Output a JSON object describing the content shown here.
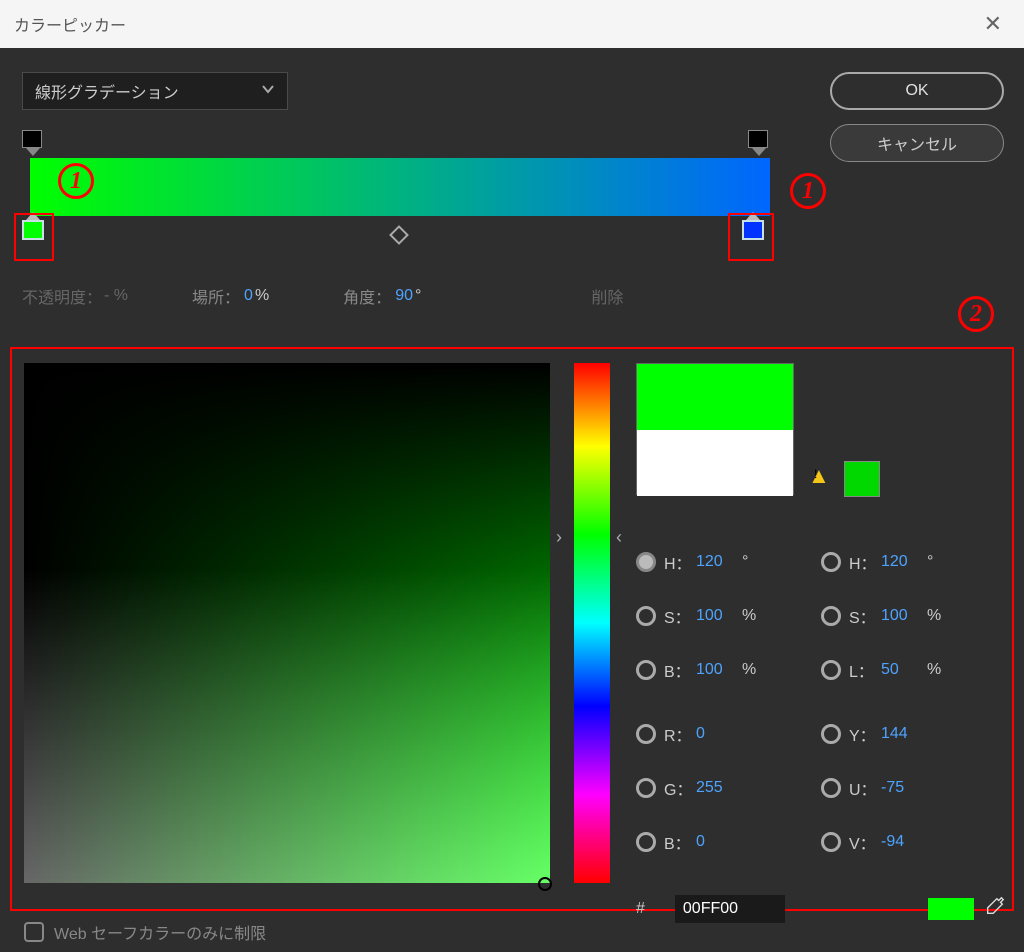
{
  "title": "カラーピッカー",
  "gradient_type": "線形グラデーション",
  "buttons": {
    "ok": "OK",
    "cancel": "キャンセル"
  },
  "gradient": {
    "start_color": "#00ff00",
    "end_color": "#0066ff"
  },
  "controls": {
    "opacity_label": "不透明度：",
    "opacity_value": "-  %",
    "location_label": "場所：",
    "location_value": "0",
    "location_unit": "%",
    "angle_label": "角度：",
    "angle_value": "90",
    "angle_unit": "°",
    "delete_label": "削除"
  },
  "annotations": {
    "one": "1",
    "two": "2"
  },
  "swatch": {
    "new_color": "#00ff00",
    "old_color": "#ffffff",
    "warn_color": "#00d800"
  },
  "hsb": {
    "h": "120",
    "s": "100",
    "b": "100"
  },
  "hsl": {
    "h": "120",
    "s": "100",
    "l": "50"
  },
  "rgb": {
    "r": "0",
    "g": "255",
    "b": "0"
  },
  "yuv": {
    "y": "144",
    "u": "-75",
    "v": "-94"
  },
  "labels": {
    "H": "H：",
    "S": "S：",
    "B": "B：",
    "L": "L：",
    "R": "R：",
    "G": "G：",
    "Y": "Y：",
    "U": "U：",
    "V": "V："
  },
  "units": {
    "deg": "°",
    "pct": "%"
  },
  "hex_prefix": "#",
  "hex_value": "00FF00",
  "websafe_label": "Web セーフカラーのみに制限"
}
